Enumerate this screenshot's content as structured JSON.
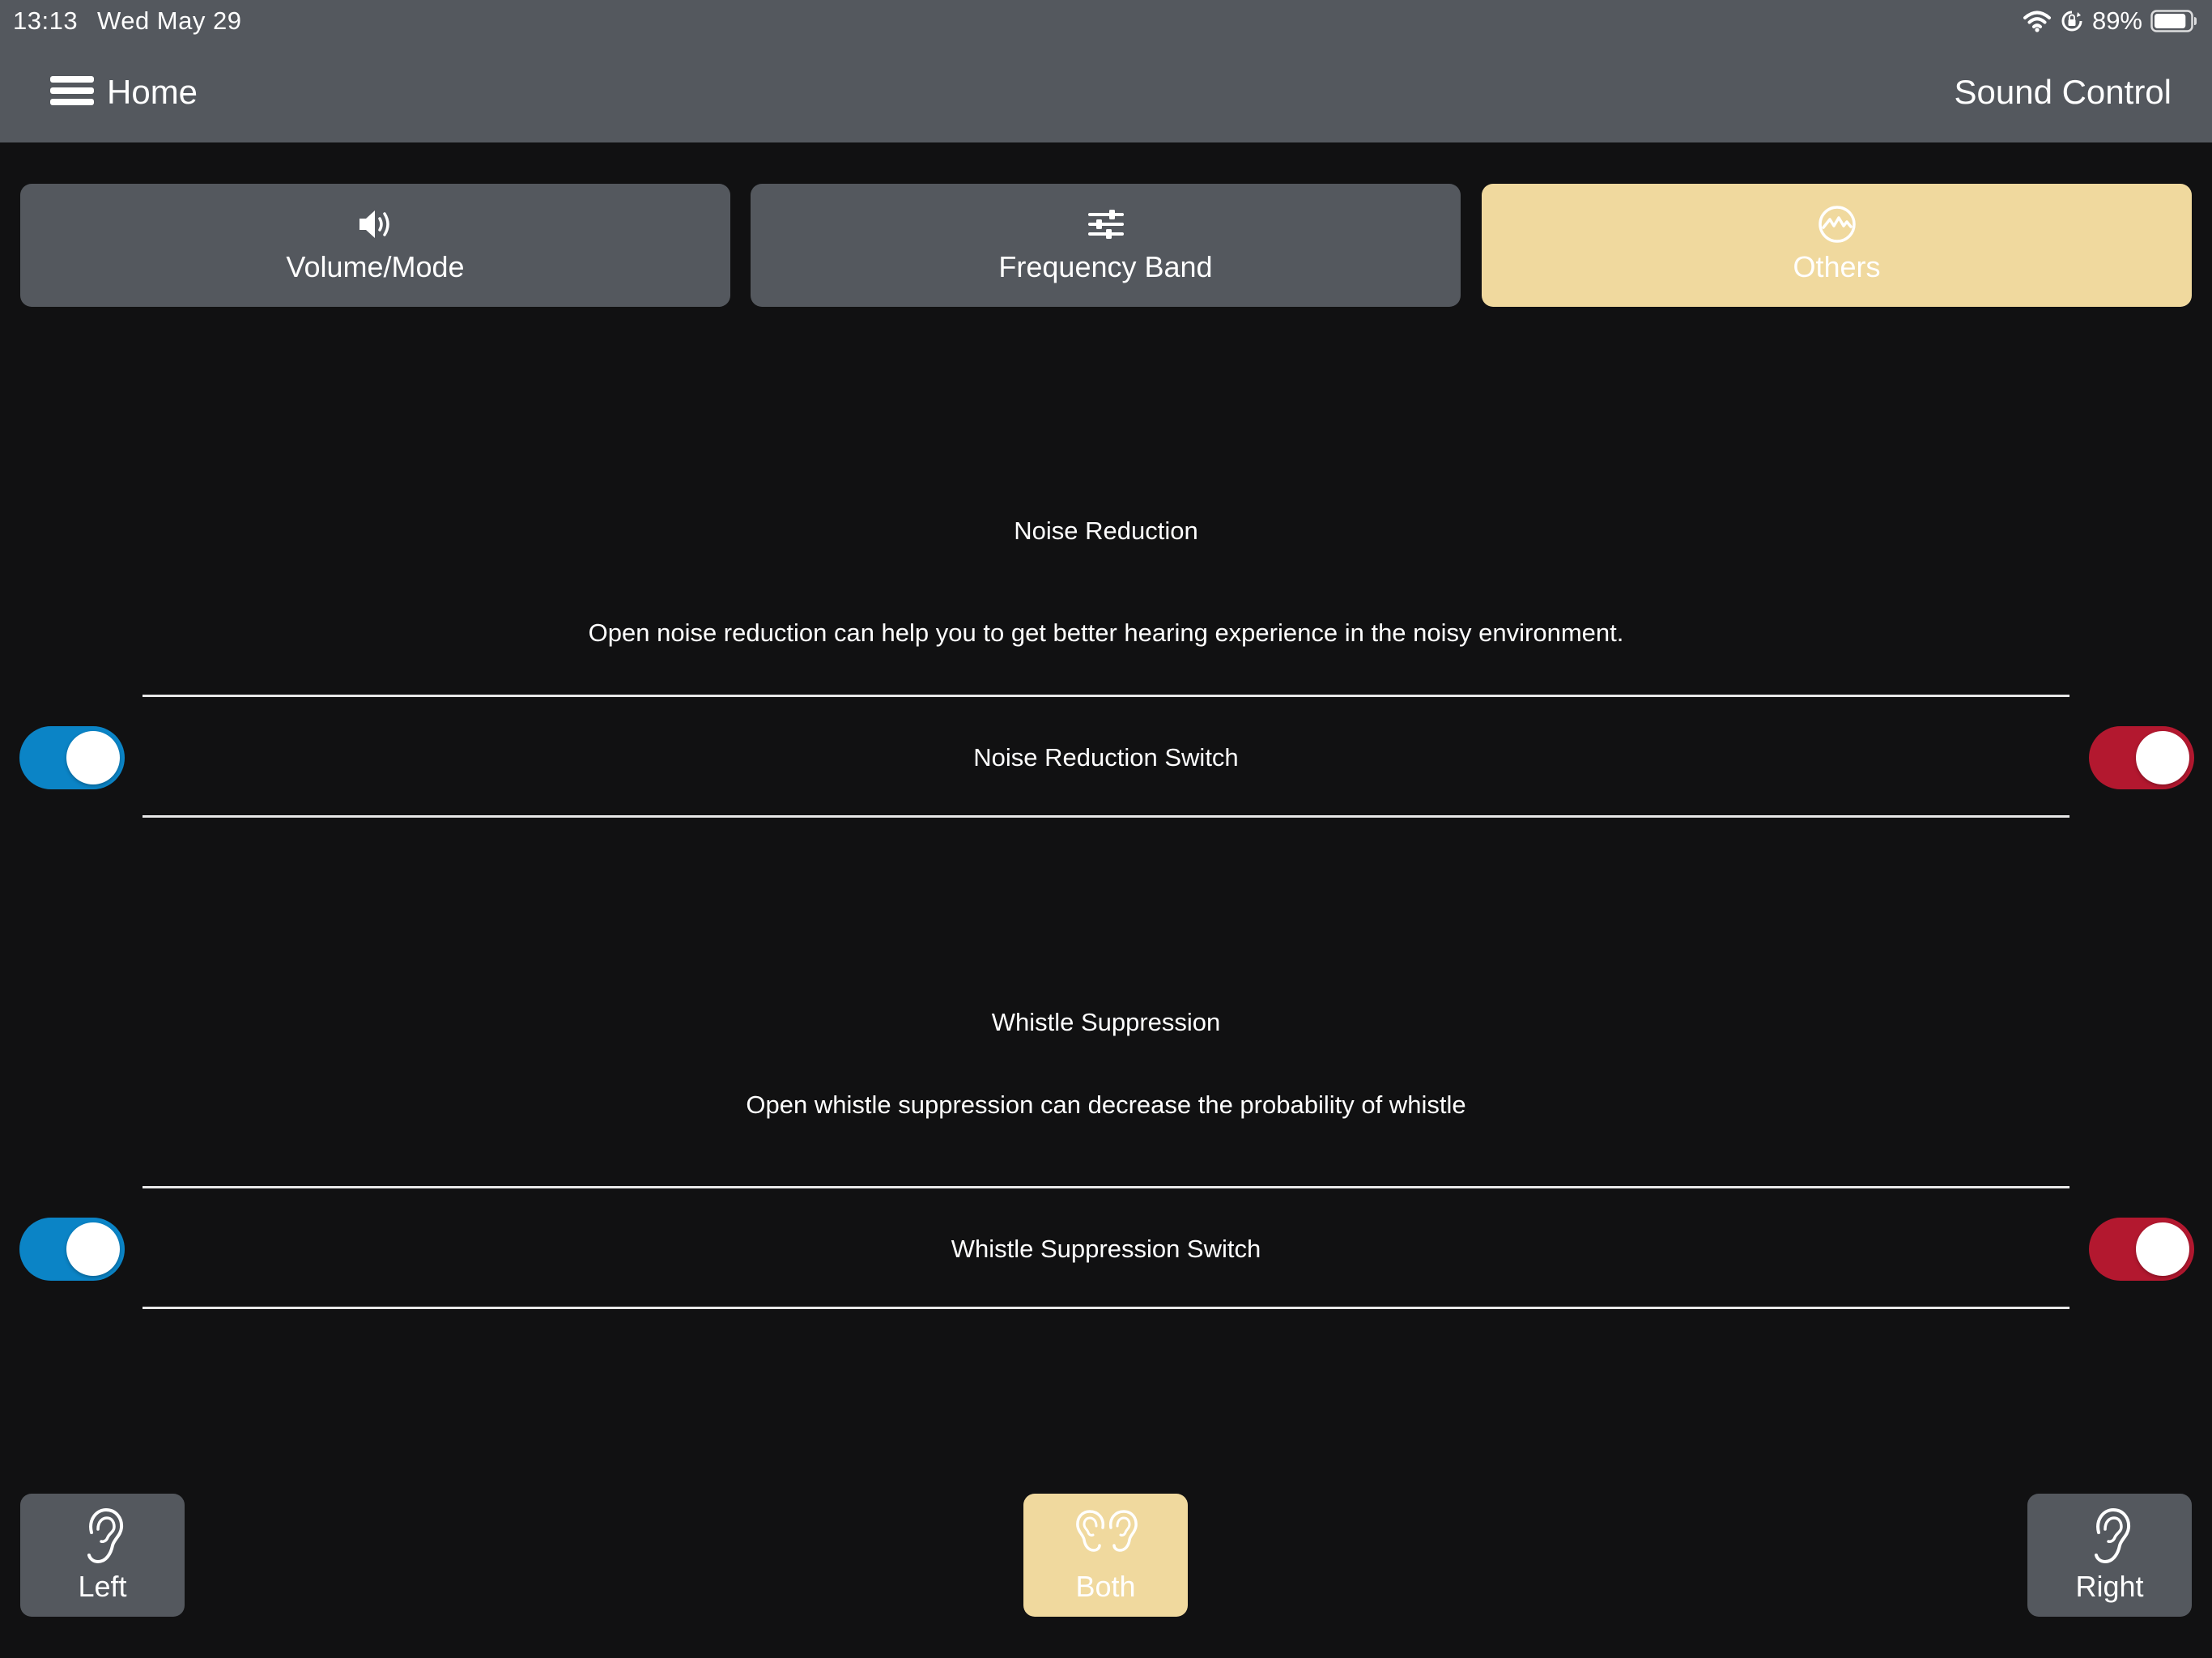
{
  "status_bar": {
    "time": "13:13",
    "date": "Wed May 29",
    "battery": "89%",
    "battery_level": 0.89
  },
  "header": {
    "home_label": "Home",
    "title": "Sound Control"
  },
  "tabs": [
    {
      "label": "Volume/Mode",
      "icon": "speaker-icon",
      "active": false
    },
    {
      "label": "Frequency Band",
      "icon": "sliders-icon",
      "active": false
    },
    {
      "label": "Others",
      "icon": "waveform-circle-icon",
      "active": true
    }
  ],
  "sections": [
    {
      "title": "Noise Reduction",
      "description": "Open noise reduction can help you to get better hearing experience in the noisy environment.",
      "switch_label": "Noise Reduction Switch",
      "left_on": true,
      "right_on": true
    },
    {
      "title": "Whistle Suppression",
      "description": "Open whistle suppression can decrease the probability of whistle",
      "switch_label": "Whistle Suppression Switch",
      "left_on": true,
      "right_on": true
    }
  ],
  "ear_buttons": [
    {
      "label": "Left",
      "icon": "left-ear-icon",
      "active": false
    },
    {
      "label": "Both",
      "icon": "both-ears-icon",
      "active": true
    },
    {
      "label": "Right",
      "icon": "right-ear-icon",
      "active": false
    }
  ],
  "colors": {
    "bar": "#54585e",
    "background": "#111112",
    "active_tab": "#f0d99e",
    "left_toggle": "#0b84c6",
    "right_toggle": "#b3182f"
  }
}
